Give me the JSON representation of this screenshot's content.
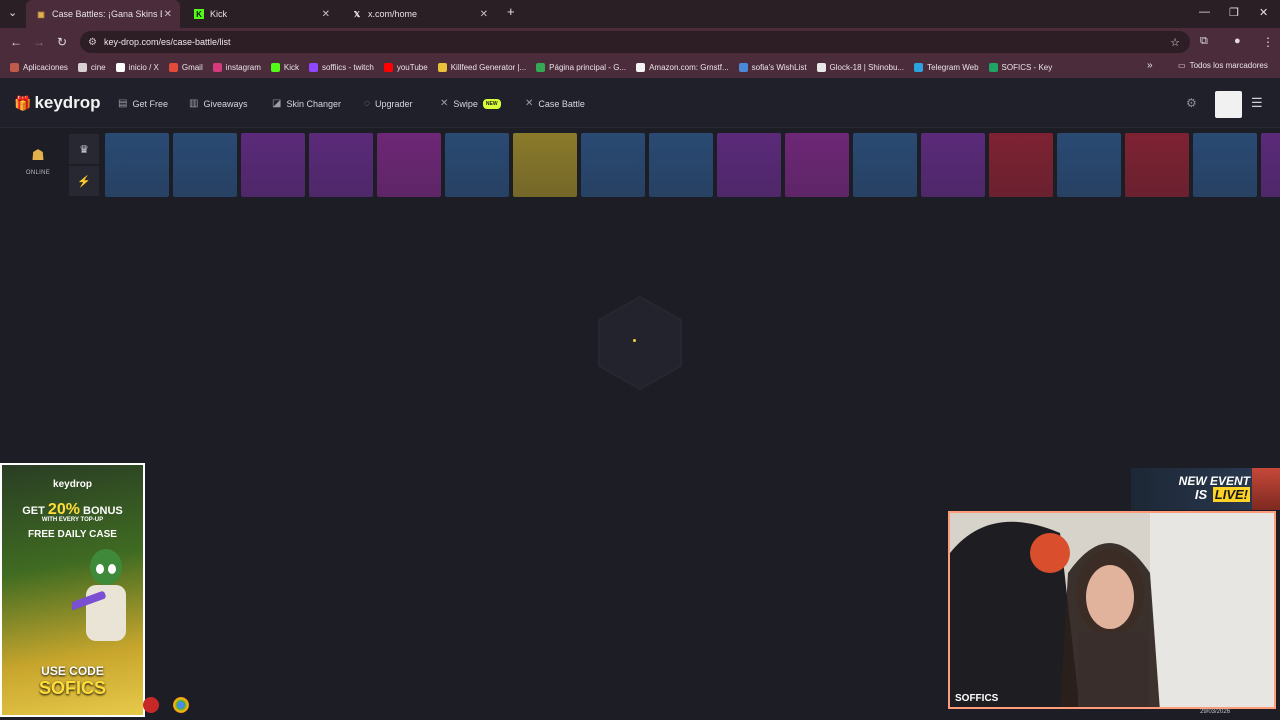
{
  "browser": {
    "tabs": [
      {
        "title": "Case Battles: ¡Gana Skins Épicos",
        "active": true
      },
      {
        "title": "Kick",
        "active": false
      },
      {
        "title": "x.com/home",
        "active": false
      }
    ],
    "new_tab": "+",
    "url": "key-drop.com/es/case-battle/list",
    "bookmarks": [
      {
        "label": "Aplicaciones",
        "icon": "apps-grid-icon",
        "color": "#c05a4a"
      },
      {
        "label": "cine",
        "icon": "folder-icon",
        "color": "#d9d0d4"
      },
      {
        "label": "inicio / X",
        "icon": "x-logo-icon",
        "color": "#ffffff"
      },
      {
        "label": "Gmail",
        "icon": "gmail-icon",
        "color": "#e24a3b"
      },
      {
        "label": "instagram",
        "icon": "instagram-icon",
        "color": "#d6397d"
      },
      {
        "label": "Kick",
        "icon": "kick-icon",
        "color": "#53fc18"
      },
      {
        "label": "soffiics - twitch",
        "icon": "twitch-icon",
        "color": "#9146ff"
      },
      {
        "label": "youTube",
        "icon": "youtube-icon",
        "color": "#ff0000"
      },
      {
        "label": "Killfeed Generator |...",
        "icon": "killfeed-icon",
        "color": "#e8c33a"
      },
      {
        "label": "Página principal - G...",
        "icon": "drive-icon",
        "color": "#34a853"
      },
      {
        "label": "Amazon.com: Grnstf...",
        "icon": "amazon-icon",
        "color": "#f3f3f3"
      },
      {
        "label": "sofia's WishList",
        "icon": "wishlist-icon",
        "color": "#4b88d8"
      },
      {
        "label": "Glock-18 | Shinobu...",
        "icon": "fandom-icon",
        "color": "#e8e8e8"
      },
      {
        "label": "Telegram Web",
        "icon": "telegram-icon",
        "color": "#2aa3e0"
      },
      {
        "label": "SOFICS - Key",
        "icon": "sheets-icon",
        "color": "#1fa463"
      }
    ],
    "bookmarks_overflow": "»",
    "all_bookmarks": "Todos los marcadores"
  },
  "site": {
    "logo": "keydrop",
    "nav": [
      {
        "label": "Get Free",
        "icon": "gift-box-icon"
      },
      {
        "label": "Giveaways",
        "icon": "giveaway-icon"
      },
      {
        "label": "Skin Changer",
        "icon": "skin-changer-icon"
      },
      {
        "label": "Upgrader",
        "icon": "upgrader-icon"
      },
      {
        "label": "Swipe",
        "icon": "swipe-icon",
        "badge": "NEW"
      },
      {
        "label": "Case Battle",
        "icon": "case-battle-icon"
      }
    ],
    "online_label": "ONLINE",
    "live_drop_colors": [
      "#2a4a73",
      "#2a4a73",
      "#5b2a7a",
      "#5b2a7a",
      "#6e2776",
      "#2a4a73",
      "#8a7a2a",
      "#2a4a73",
      "#2a4a73",
      "#5b2a7a",
      "#6e2776",
      "#2a4a73",
      "#5b2a7a",
      "#7e2232",
      "#2a4a73",
      "#7e2232",
      "#2a4a73",
      "#5b2a7a"
    ]
  },
  "overlays": {
    "promo": {
      "brand": "keydrop",
      "line1_prefix": "GET ",
      "line1_percent": "20%",
      "line1_suffix": " BONUS",
      "line2": "WITH EVERY TOP-UP",
      "line3": "FREE DAILY CASE",
      "use_code": "USE CODE",
      "code": "SOFICS"
    },
    "event": {
      "line1": "NEW EVENT",
      "line2_prefix": "IS ",
      "line2_highlight": "LIVE!"
    },
    "webcam_name": "SOFFICS",
    "clock": "29/03/2026"
  }
}
